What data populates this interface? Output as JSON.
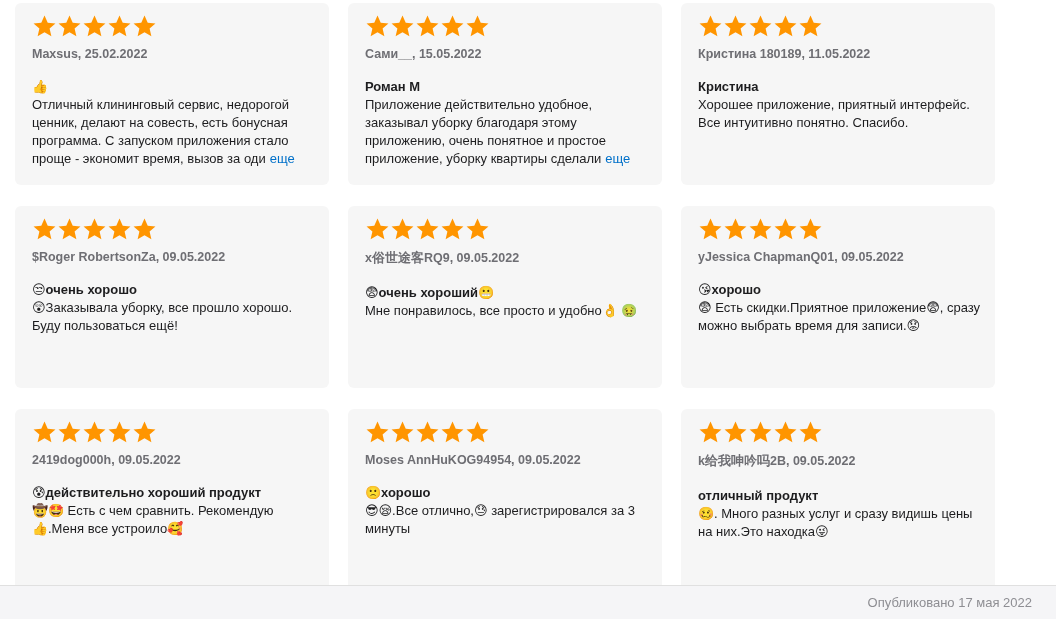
{
  "reviews": [
    {
      "stars": 5,
      "author": "Maxsus, 25.02.2022",
      "title": "👍",
      "body": "Отличный клининговый сервис, недорогой ценник, делают на совесть, есть бонусная программа. С запуском приложения стало проще - экономит время, вызов за оди",
      "more": "еще"
    },
    {
      "stars": 5,
      "author": "Сами__, 15.05.2022",
      "title": "Роман М",
      "body": "Приложение действительно удобное, заказывал уборку благодаря этому приложению, очень понятное и простое приложение, уборку квартиры сделали",
      "more": "еще"
    },
    {
      "stars": 5,
      "author": "Кристина 180189, 11.05.2022",
      "title": "Кристина",
      "body": "Хорошее приложение, приятный интерфейс. Все интуитивно понятно. Спасибо."
    },
    {
      "stars": 5,
      "author": "$Roger RobertsonZa, 09.05.2022",
      "title": "😒очень хорошо",
      "body": "😲Заказывала уборку, все прошло хорошо. Буду пользоваться ещё!"
    },
    {
      "stars": 5,
      "author": "x俗世途客RQ9, 09.05.2022",
      "title": "😨очень хороший😬",
      "body": "Мне понравилось, все просто и удобно👌 🤢"
    },
    {
      "stars": 5,
      "author": "yJessica ChapmanQ01, 09.05.2022",
      "title": "😘хорошо",
      "body": "😨 Есть скидки.Приятное приложение😨, сразу можно выбрать время для записи.😟"
    },
    {
      "stars": 5,
      "author": "2419dog000h, 09.05.2022",
      "title": "😰действительно хороший продукт",
      "body": "🤠🤩 Есть с чем сравнить. Рекомендую 👍.Меня все устроило🥰"
    },
    {
      "stars": 5,
      "author": "Moses AnnHuKOG94954, 09.05.2022",
      "title": "🙁хорошо",
      "body": "😎😪.Все отлично,😓 зарегистрировался за 3 минуты"
    },
    {
      "stars": 5,
      "author": "k给我呻吟吗2B, 09.05.2022",
      "title": "отличный продукт",
      "body": "🥴. Много разных услуг и сразу видишь цены на них.Это находка😜"
    }
  ],
  "footer": "Опубликовано 17 мая 2022"
}
